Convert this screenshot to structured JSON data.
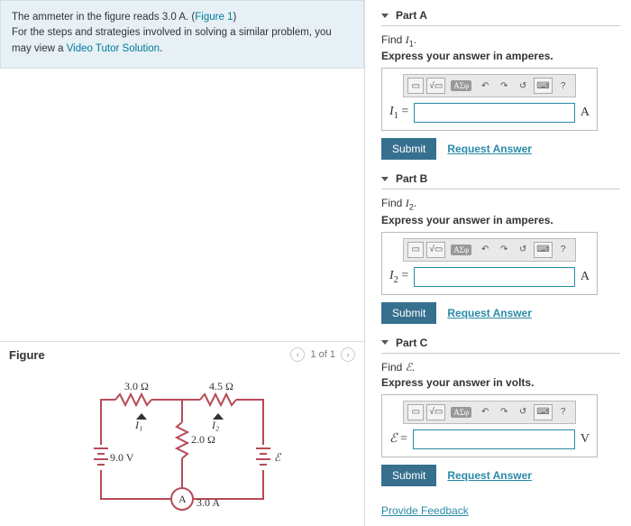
{
  "intro": {
    "line1a": "The ammeter in the figure reads 3.0 A. (",
    "fig_link": "Figure 1",
    "line1b": ")",
    "line2a": "For the steps and strategies involved in solving a similar problem, you may view a ",
    "video_link": "Video Tutor Solution",
    "period": "."
  },
  "figure": {
    "title": "Figure",
    "pager": "1 of 1",
    "r1": "3.0 Ω",
    "r2": "4.5 Ω",
    "r3": "2.0 Ω",
    "i1": "I₁",
    "i2": "I₂",
    "v": "9.0 V",
    "emf": "ℰ",
    "ammeter_sym": "A",
    "ammeter_val": "3.0 A"
  },
  "toolbar": {
    "sym": "ΑΣφ",
    "undo": "↶",
    "redo": "↷",
    "reset": "↺",
    "kbd": "⌨",
    "help": "?"
  },
  "parts": {
    "a": {
      "title": "Part A",
      "find": "Find I₁.",
      "instruct": "Express your answer in amperes.",
      "var": "I₁ =",
      "unit": "A"
    },
    "b": {
      "title": "Part B",
      "find": "Find I₂.",
      "instruct": "Express your answer in amperes.",
      "var": "I₂ =",
      "unit": "A"
    },
    "c": {
      "title": "Part C",
      "find": "Find ℰ.",
      "instruct": "Express your answer in volts.",
      "var": "ℰ =",
      "unit": "V"
    }
  },
  "buttons": {
    "submit": "Submit",
    "request": "Request Answer",
    "feedback": "Provide Feedback"
  }
}
